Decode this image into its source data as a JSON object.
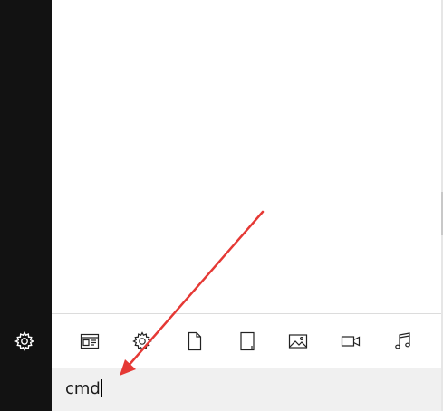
{
  "rail": {
    "settings_icon": "gear-icon"
  },
  "filters": [
    {
      "name": "apps-filter",
      "icon": "apps-window-icon"
    },
    {
      "name": "settings-filter",
      "icon": "gear-icon"
    },
    {
      "name": "documents-filter",
      "icon": "document-icon"
    },
    {
      "name": "folders-filter",
      "icon": "tablet-document-icon"
    },
    {
      "name": "photos-filter",
      "icon": "photo-icon"
    },
    {
      "name": "videos-filter",
      "icon": "video-camera-icon"
    },
    {
      "name": "music-filter",
      "icon": "music-note-icon"
    }
  ],
  "search": {
    "query": "cmd"
  },
  "annotation": {
    "arrow_color": "#e53935"
  }
}
